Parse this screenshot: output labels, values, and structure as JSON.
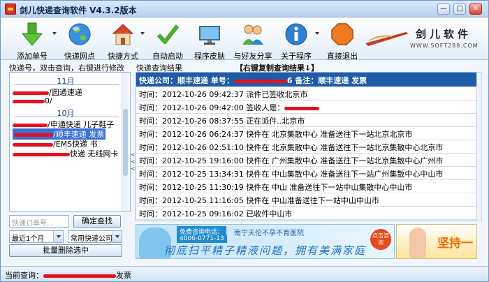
{
  "window": {
    "title": "剑儿快递查询软件 V4.3.2版本",
    "controls": {
      "minimize": "—",
      "maximize": "□",
      "close": "✕"
    }
  },
  "toolbar": {
    "items": [
      {
        "label": "添加单号",
        "icon": "green-down-arrow-icon"
      },
      {
        "label": "快递网点",
        "icon": "globe-icon"
      },
      {
        "label": "快捷方式",
        "icon": "house-icon"
      },
      {
        "label": "自动启动",
        "icon": "check-icon"
      },
      {
        "label": "程序皮肤",
        "icon": "monitor-icon"
      },
      {
        "label": "与好友分享",
        "icon": "people-icon"
      },
      {
        "label": "关于程序",
        "icon": "info-icon"
      },
      {
        "label": "直接退出",
        "icon": "stop-icon"
      }
    ],
    "brand_name": "剑儿软件",
    "brand_url": "WWW.SOFT288.COM"
  },
  "left_panel": {
    "title": "快递号，双击查询，右键进行修改",
    "groups": [
      {
        "month": "11月",
        "entries": [
          "/圆通速递",
          "0/"
        ]
      },
      {
        "month": "10月",
        "entries": [
          "/申通快递 儿子鞋子",
          "/顺丰速递 发票",
          "/EMS快递 书",
          "快递 无线网卡"
        ]
      }
    ],
    "selected_entry": "/顺丰速递 发票",
    "collapse_arrows": "<<<"
  },
  "search": {
    "placeholder": "快递订单号...",
    "search_button": "确定查找",
    "period_select": "最近1个月",
    "company_select": "常用快递公司",
    "batch_delete_button": "批量删除选中"
  },
  "right_panel": {
    "title": "快递查询结果",
    "copy_hint": "【右键复制查询结果↓】",
    "header": {
      "company": "快递公司：顺丰速递",
      "number_label": "单号：",
      "number_tail": "6",
      "remark": "备注：顺丰速递 发票"
    },
    "rows": [
      "时间：2012-10-26 09:42:37 派件已签收北京市",
      "时间：2012-10-26 09:42:00 签收人是：",
      "时间：2012-10-26 08:37:55 正在派件..北京市",
      "时间：2012-10-26 06:24:37 快件在 北京集散中心 准备送往下一站北京北京市",
      "时间：2012-10-26 02:51:10 快件在 北京集散中心 准备送往下一站北京集散中心北京市",
      "时间：2012-10-25 19:16:00 快件在 广州集散中心 准备送往下一站北京集散中心广州市",
      "时间：2012-10-25 13:34:31 快件在 中山集散中心 准备送往下一站广州集散中心中山市",
      "时间：2012-10-25 11:30:19 快件在 中山 准备送往下一站中山集散中心中山市",
      "时间：2012-10-25 11:16:05 快件在 中山准备送往下一站中山中山市",
      "时间：2012-10-25 09:16:02 已收件中山市"
    ]
  },
  "ads": {
    "hotline_label": "免费咨询电话：",
    "hotline_number": "4006-0771-13",
    "hospital": "南宁天伦不孕不育医院",
    "slogan": "彻底扫平精子精液问题，拥有美满家庭",
    "tag": "点击咨询",
    "right_text": "坚持一"
  },
  "status": {
    "label": "当前查询：",
    "tail": "发票"
  },
  "colors": {
    "header_bg": "#1e5ca8",
    "selection": "#3b70d6",
    "redaction": "#e8101e"
  }
}
